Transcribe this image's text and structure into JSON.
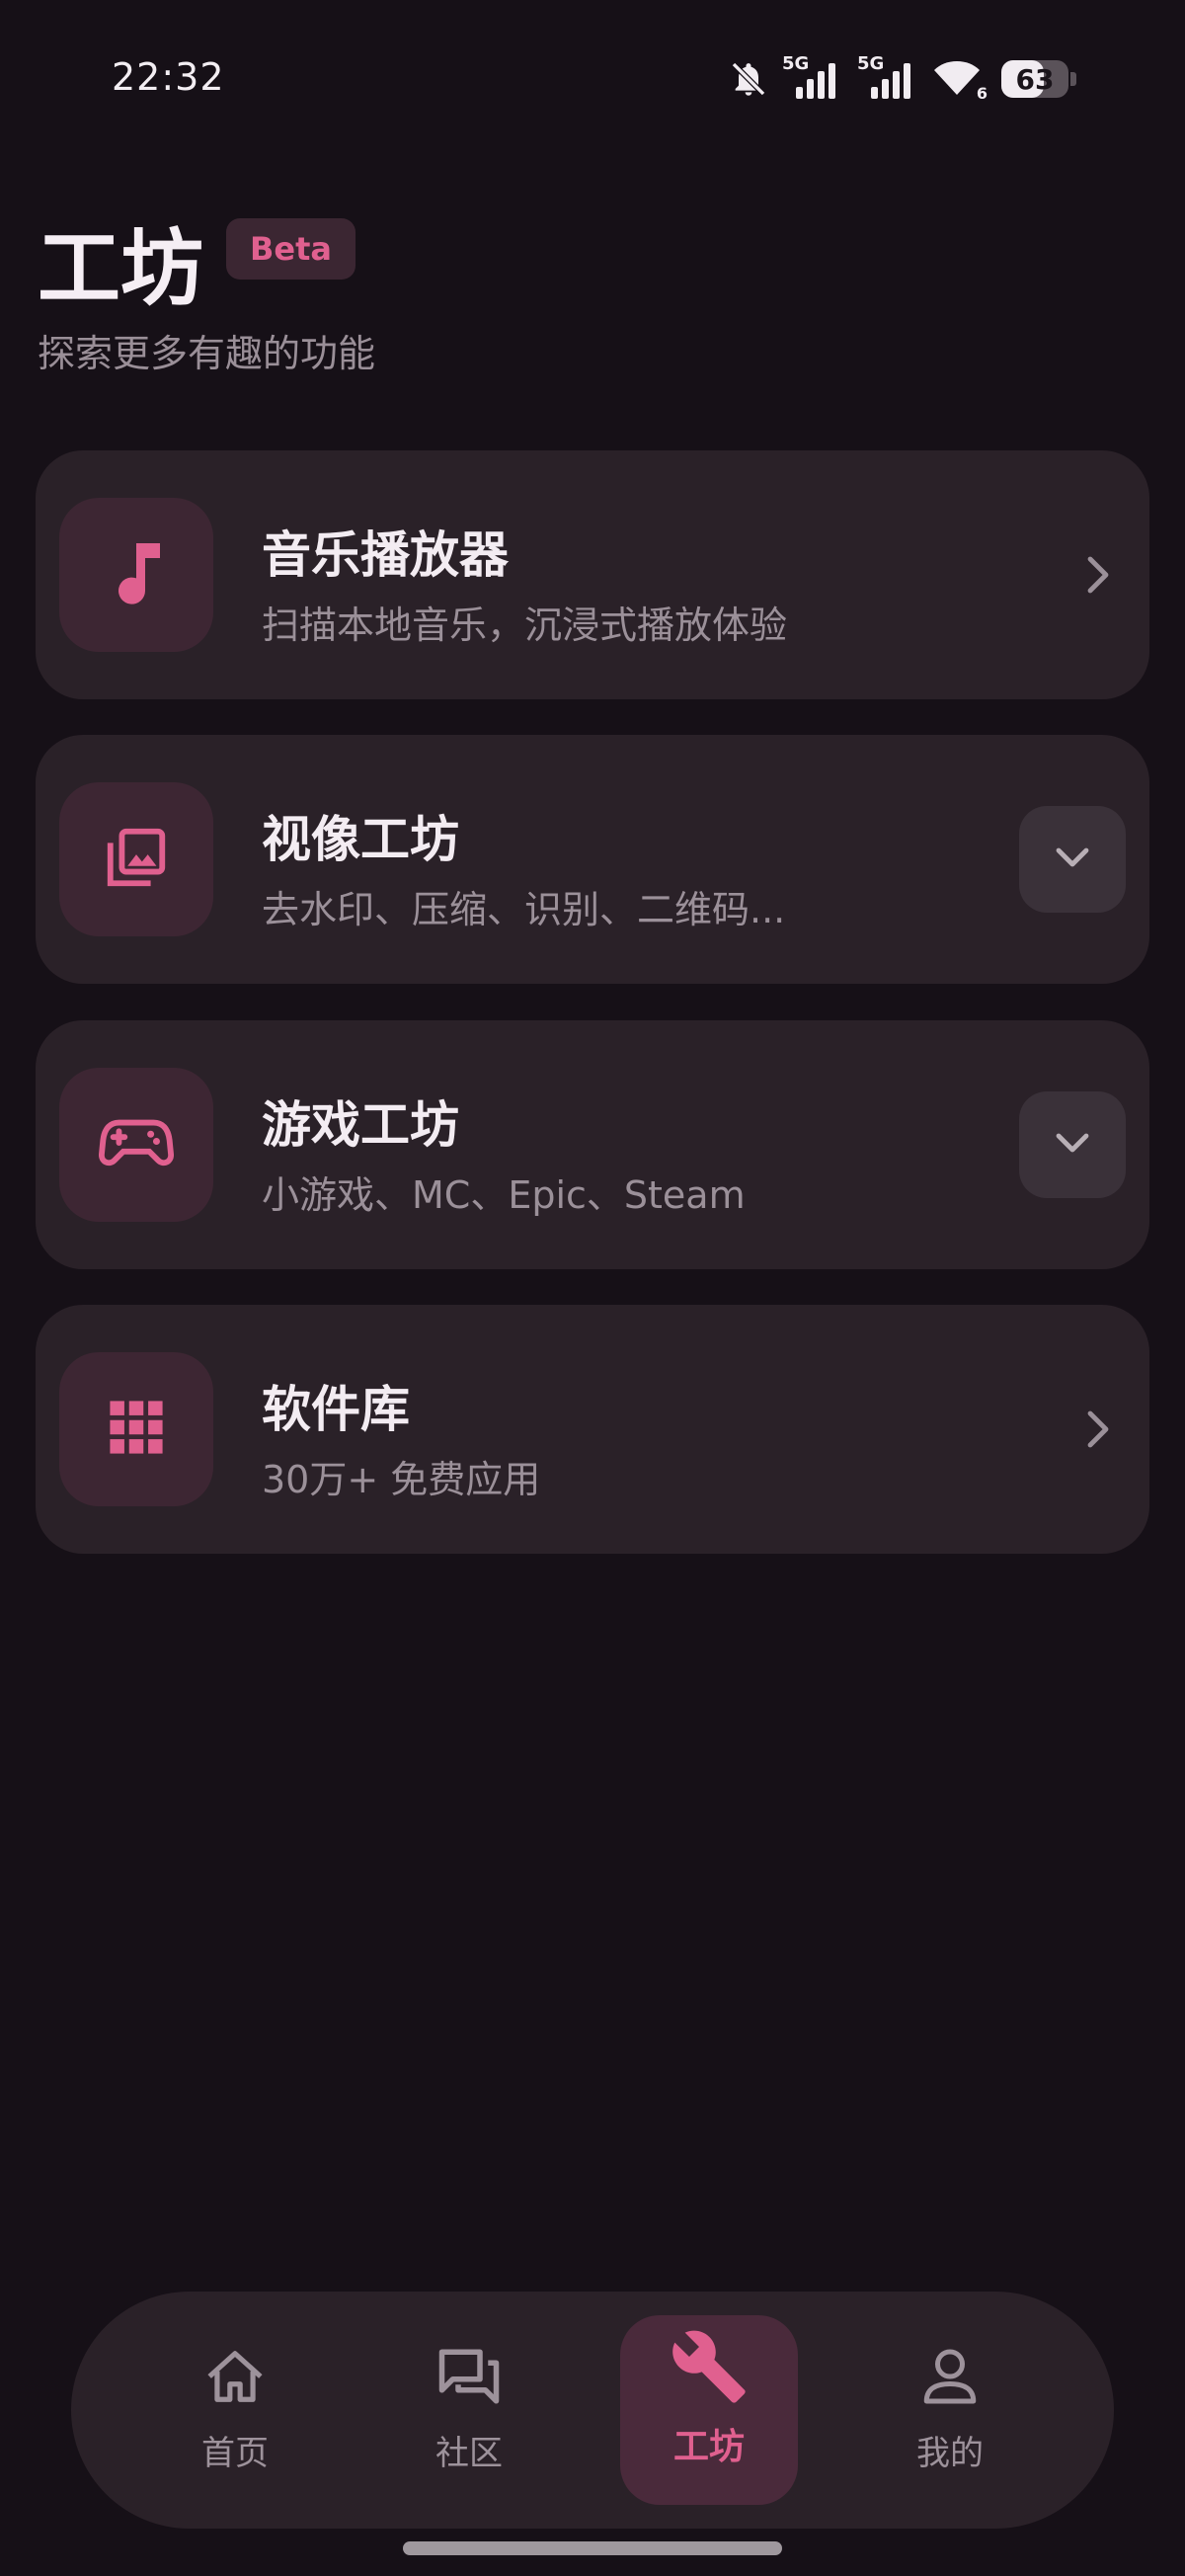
{
  "status_bar": {
    "time": "22:32",
    "network_1": "5G",
    "network_2": "5G",
    "wifi_label": "6",
    "battery": "63",
    "battery_level": 0.63,
    "icons": [
      "bell-off-icon",
      "signal-icon",
      "signal-icon",
      "wifi-icon",
      "battery-icon"
    ]
  },
  "header": {
    "title": "工坊",
    "badge": "Beta",
    "subtitle": "探索更多有趣的功能"
  },
  "cards": [
    {
      "title": "音乐播放器",
      "desc": "扫描本地音乐，沉浸式播放体验",
      "icon": "music-note-icon",
      "action": "chevron-right-icon"
    },
    {
      "title": "视像工坊",
      "desc": "去水印、压缩、识别、二维码...",
      "icon": "photo-library-icon",
      "action": "chevron-down-icon"
    },
    {
      "title": "游戏工坊",
      "desc": "小游戏、MC、Epic、Steam",
      "icon": "gamepad-icon",
      "action": "chevron-down-icon"
    },
    {
      "title": "软件库",
      "desc": "30万+ 免费应用",
      "icon": "apps-grid-icon",
      "action": "chevron-right-icon"
    }
  ],
  "bottom_nav": {
    "items": [
      {
        "label": "首页",
        "icon": "home-icon"
      },
      {
        "label": "社区",
        "icon": "forum-icon"
      },
      {
        "label": "工坊",
        "icon": "wrench-icon",
        "active": true
      },
      {
        "label": "我的",
        "icon": "person-icon"
      }
    ]
  },
  "colors": {
    "background": "#161017",
    "card": "#2a2128",
    "icon_tile": "#3d2633",
    "accent": "#e0608f",
    "text_primary": "#f3ecf2",
    "text_secondary": "#9b9099"
  }
}
